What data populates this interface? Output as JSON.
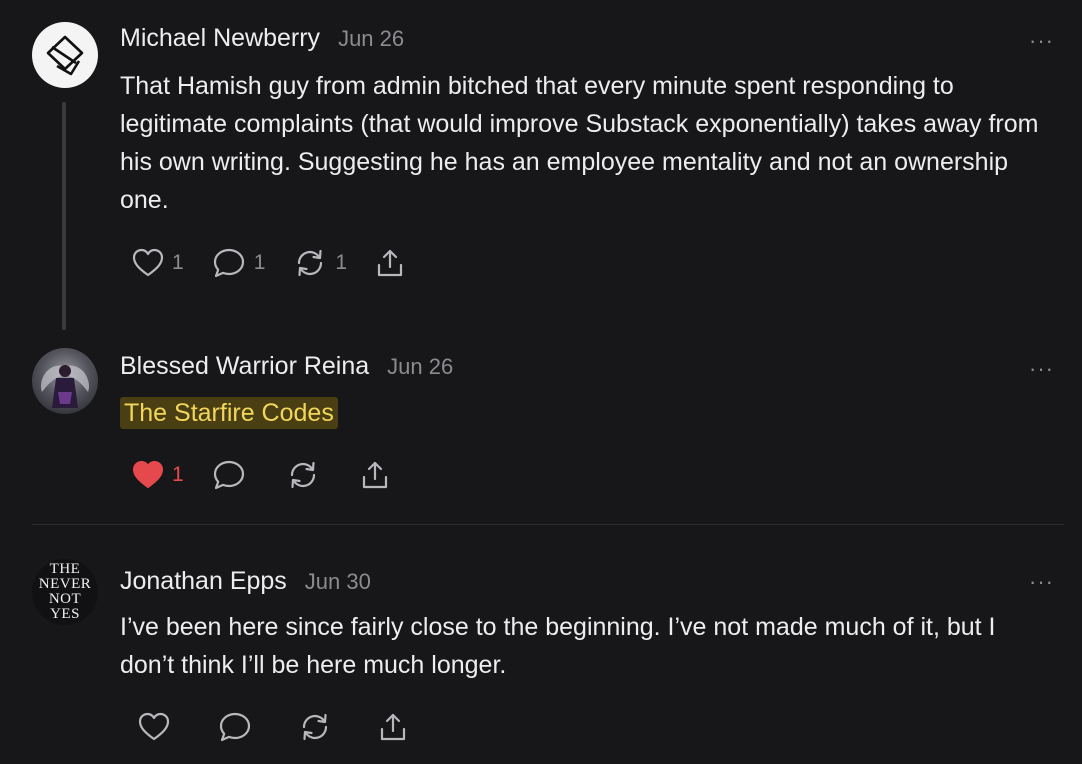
{
  "comments": [
    {
      "author": "Michael Newberry",
      "date": "Jun 26",
      "more": "···",
      "text": "That Hamish guy from admin bitched that every minute spent responding to legitimate complaints (that would improve Substack exponentially) takes away from his own writing. Suggesting he has an employee mentality and not an ownership one.",
      "likes": "1",
      "replies": "1",
      "restacks": "1"
    },
    {
      "author": "Blessed Warrior Reina",
      "date": "Jun 26",
      "more": "···",
      "text": "The Starfire Codes",
      "likes": "1"
    },
    {
      "author": "Jonathan Epps",
      "date": "Jun 30",
      "more": "···",
      "text": "I’ve been here since fairly close to the beginning. I’ve not made much of it, but I don’t think I’ll be here much longer.",
      "avatar_text": [
        "THE",
        "NEVER",
        "NOT",
        "YES"
      ]
    }
  ],
  "icons": {
    "like": "heart-icon",
    "like_filled": "heart-filled-icon",
    "reply": "comment-icon",
    "restack": "restack-icon",
    "share": "share-icon",
    "more": "more-icon"
  },
  "colors": {
    "background": "#17171a",
    "text": "#ededed",
    "muted": "#8c8c90",
    "like_active": "#e5484d",
    "highlight_bg": "#4a3f12",
    "highlight_text": "#f2d65c"
  }
}
